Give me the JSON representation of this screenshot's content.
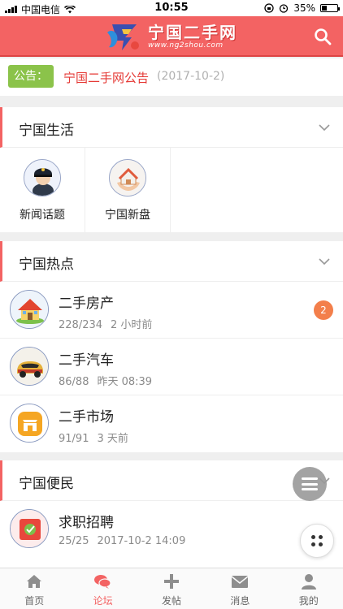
{
  "status_bar": {
    "carrier": "中国电信",
    "time": "10:55",
    "battery": "35%"
  },
  "header": {
    "brand": "宁国二手网",
    "url": "www.ng2shou.com"
  },
  "notice": {
    "tag": "公告：",
    "title": "宁国二手网公告",
    "date": "(2017-10-2)"
  },
  "sections": {
    "life": {
      "title": "宁国生活",
      "items": [
        {
          "label": "新闻话题",
          "icon": "police-avatar-icon"
        },
        {
          "label": "宁国新盘",
          "icon": "house-hands-icon"
        }
      ]
    },
    "hot": {
      "title": "宁国热点",
      "items": [
        {
          "name": "二手房产",
          "count": "228/234",
          "time": "2 小时前",
          "badge": "2",
          "icon": "house-icon"
        },
        {
          "name": "二手汽车",
          "count": "86/88",
          "time": "昨天 08:39",
          "icon": "car-icon"
        },
        {
          "name": "二手市场",
          "count": "91/91",
          "time": "3 天前",
          "icon": "market-icon"
        }
      ]
    },
    "service": {
      "title": "宁国便民",
      "items": [
        {
          "name": "求职招聘",
          "count": "25/25",
          "time": "2017-10-2 14:09",
          "icon": "job-icon"
        }
      ]
    }
  },
  "tabbar": [
    {
      "label": "首页",
      "icon": "home-icon"
    },
    {
      "label": "论坛",
      "icon": "forum-icon",
      "active": true
    },
    {
      "label": "发帖",
      "icon": "plus-icon"
    },
    {
      "label": "消息",
      "icon": "mail-icon"
    },
    {
      "label": "我的",
      "icon": "user-icon"
    }
  ],
  "colors": {
    "accent": "#f36363",
    "notice_tag": "#8bc34a",
    "badge": "#f37f4b",
    "active_tab": "#f36363"
  }
}
